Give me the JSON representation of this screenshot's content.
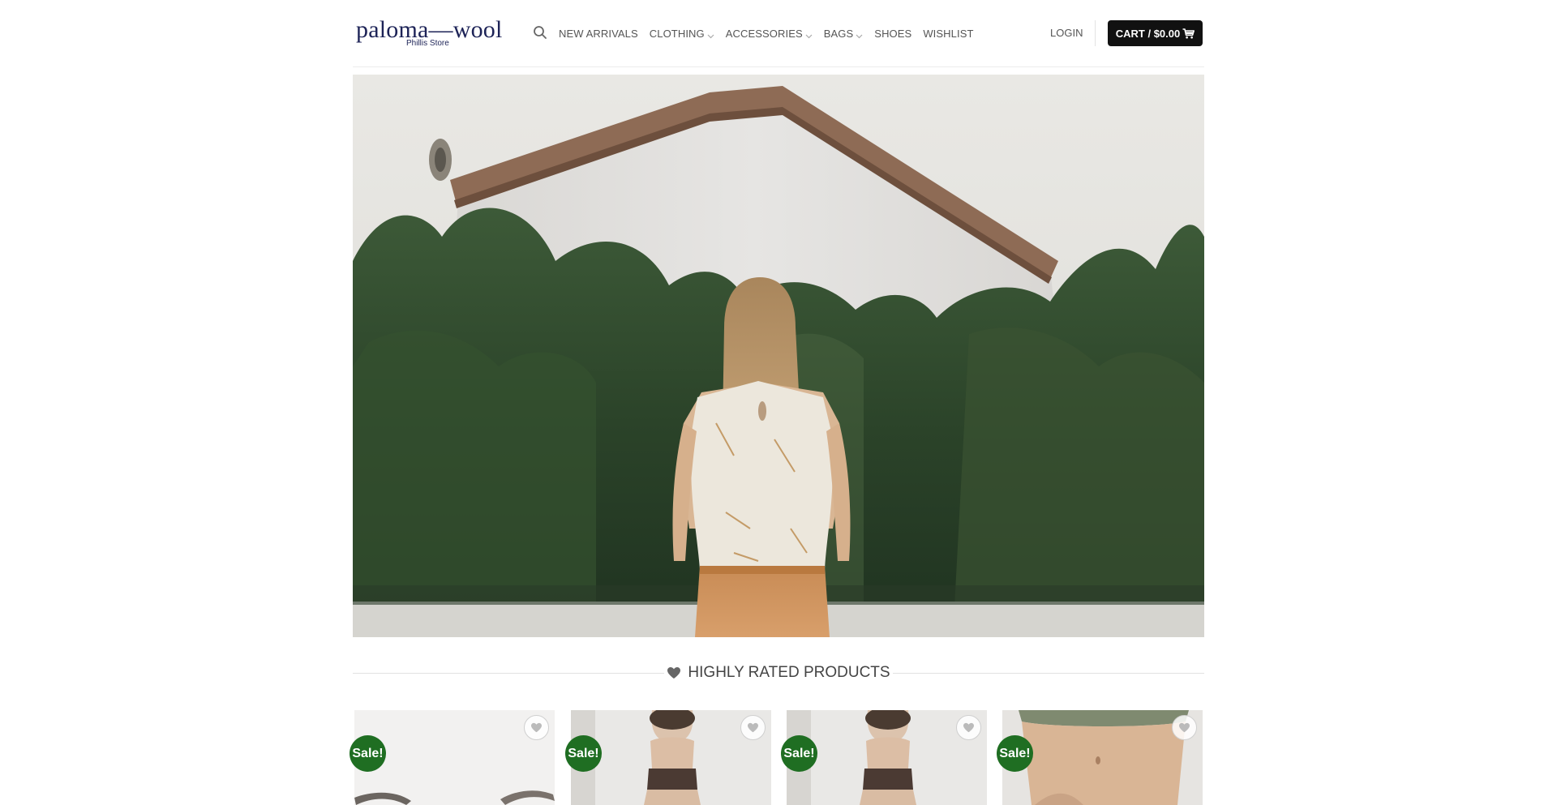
{
  "logo": {
    "name": "paloma—wool",
    "subtitle": "Phillis Store",
    "color": "#1d2357"
  },
  "header": {
    "search_icon": "search-icon",
    "nav": [
      {
        "label": "NEW ARRIVALS",
        "dropdown": false
      },
      {
        "label": "CLOTHING",
        "dropdown": true
      },
      {
        "label": "ACCESSORIES",
        "dropdown": true
      },
      {
        "label": "BAGS",
        "dropdown": true
      },
      {
        "label": "SHOES",
        "dropdown": false
      },
      {
        "label": "WISHLIST",
        "dropdown": false
      }
    ],
    "login_label": "LOGIN",
    "cart_label": "CART / $0.00",
    "cart_icon": "cart-icon"
  },
  "hero": {
    "image_alt": "Woman seen from behind wearing a sleeveless top in front of a house and hedge"
  },
  "section": {
    "title": "HIGHLY RATED PRODUCTS",
    "icon": "heart-icon"
  },
  "products": [
    {
      "badge": "Sale!",
      "wishlist_icon": "heart-icon"
    },
    {
      "badge": "Sale!",
      "wishlist_icon": "heart-icon"
    },
    {
      "badge": "Sale!",
      "wishlist_icon": "heart-icon"
    },
    {
      "badge": "Sale!",
      "wishlist_icon": "heart-icon"
    }
  ],
  "colors": {
    "sale_badge": "#1f6e22",
    "cart_button": "#111111",
    "nav_text": "#555555"
  }
}
